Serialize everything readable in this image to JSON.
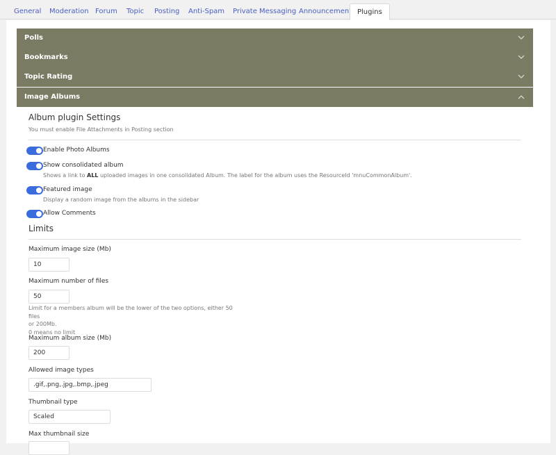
{
  "tabs": [
    {
      "label": "General"
    },
    {
      "label": "Moderation"
    },
    {
      "label": "Forum"
    },
    {
      "label": "Topic"
    },
    {
      "label": "Posting"
    },
    {
      "label": "Anti-Spam"
    },
    {
      "label": "Private Messaging"
    },
    {
      "label": "Announcement"
    },
    {
      "label": "Plugins",
      "active": true
    }
  ],
  "accordion": [
    {
      "label": "Polls",
      "expanded": false,
      "icon": "chevron-down-icon"
    },
    {
      "label": "Bookmarks",
      "expanded": false,
      "icon": "chevron-down-icon"
    },
    {
      "label": "Topic Rating",
      "expanded": false,
      "icon": "chevron-down-icon"
    },
    {
      "label": "Image Albums",
      "expanded": true,
      "icon": "chevron-up-icon"
    }
  ],
  "album": {
    "title": "Album plugin Settings",
    "hint": "You must enable File Attachments in Posting section",
    "toggles": [
      {
        "label": "Enable Photo Albums",
        "on": true
      },
      {
        "label": "Show consolidated album",
        "on": true,
        "desc_prefix": "Shows a link to ",
        "desc_bold": "ALL",
        "desc_suffix": " uploaded images in one consolidated Album. The label for the album uses the ResourceId 'mnuCommonAlbum'."
      },
      {
        "label": "Featured image",
        "on": true,
        "desc": "Display a random image from the albums in the sidebar"
      },
      {
        "label": "Allow Comments",
        "on": true
      }
    ]
  },
  "limits": {
    "title": "Limits",
    "fields": [
      {
        "label": "Maximum image size (Mb)",
        "value": "10"
      },
      {
        "label": "Maximum number of files",
        "value": "50",
        "hint": [
          "Limit for a members album will be the lower of the two options, either 50 files",
          "or 200Mb.",
          "0 means no limit"
        ]
      },
      {
        "label": "Maximum album size (Mb)",
        "value": "200"
      },
      {
        "label": "Allowed image types",
        "value": ".gif,.png,.jpg,.bmp,.jpeg"
      },
      {
        "label": "Thumbnail type",
        "value": "Scaled"
      },
      {
        "label": "Max thumbnail size",
        "value": ""
      }
    ]
  },
  "colors": {
    "accordion_bg": "#7b7b64",
    "toggle_on": "#3b6cdd",
    "tab_link": "#4a5fc1"
  }
}
